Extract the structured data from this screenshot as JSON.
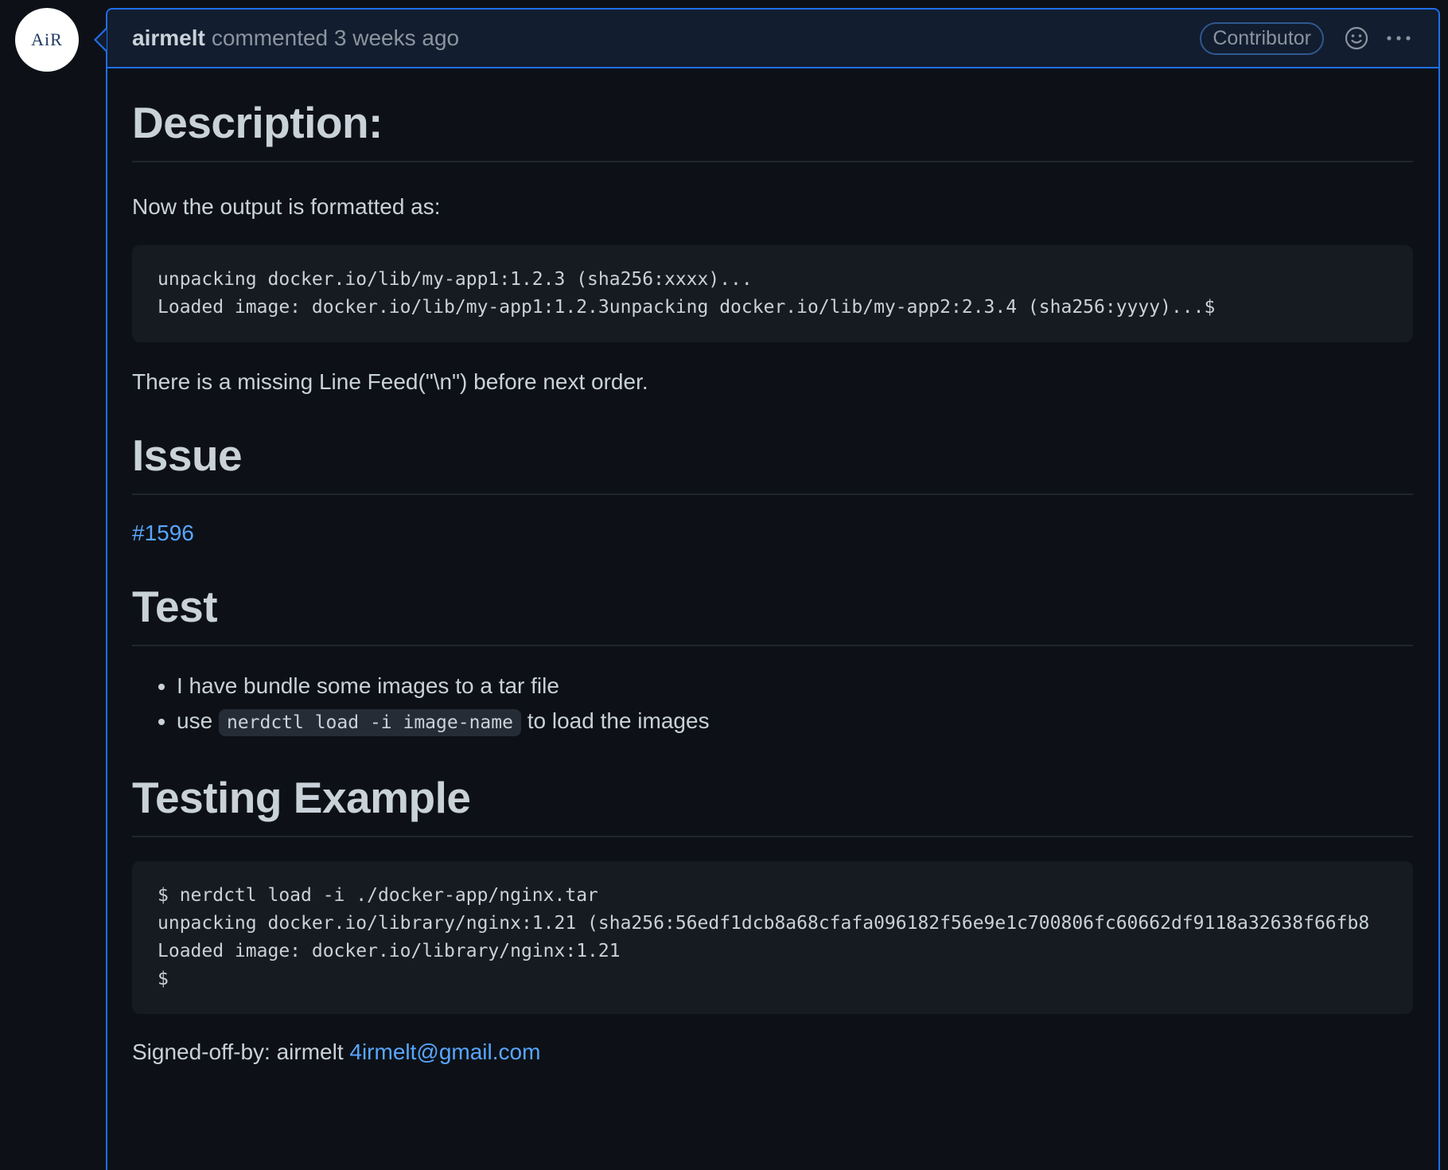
{
  "avatar": {
    "text": "AiR"
  },
  "header": {
    "author": "airmelt",
    "meta": "commented 3 weeks ago",
    "badge": "Contributor",
    "emoji_icon": "smiley-icon",
    "more_icon": "kebab-horizontal-icon"
  },
  "sections": {
    "description": {
      "heading": "Description:",
      "intro": "Now the output is formatted as:",
      "code_lines": [
        "unpacking docker.io/lib/my-app1:1.2.3 (sha256:xxxx)...",
        "Loaded image: docker.io/lib/my-app1:1.2.3unpacking docker.io/lib/my-app2:2.3.4 (sha256:yyyy)...$"
      ],
      "note": "There is a missing Line Feed(\"\\n\") before next order."
    },
    "issue": {
      "heading": "Issue",
      "link": "#1596"
    },
    "test": {
      "heading": "Test",
      "item1": "I have bundle some images to a tar file",
      "item2_prefix": "use",
      "item2_code": "nerdctl load -i image-name",
      "item2_suffix": "to load the images"
    },
    "testing_example": {
      "heading": "Testing Example",
      "code_lines": [
        "$ nerdctl load -i ./docker-app/nginx.tar",
        "unpacking docker.io/library/nginx:1.21 (sha256:56edf1dcb8a68cfafa096182f56e9e1c700806fc60662df9118a32638f66fb8",
        "Loaded image: docker.io/library/nginx:1.21",
        "$"
      ]
    },
    "signoff": {
      "prefix": "Signed-off-by: airmelt",
      "email": "4irmelt@gmail.com"
    }
  },
  "colors": {
    "accent": "#1f6feb",
    "link": "#58a6ff",
    "background": "#0d1117",
    "header_bg": "#121d2f"
  }
}
